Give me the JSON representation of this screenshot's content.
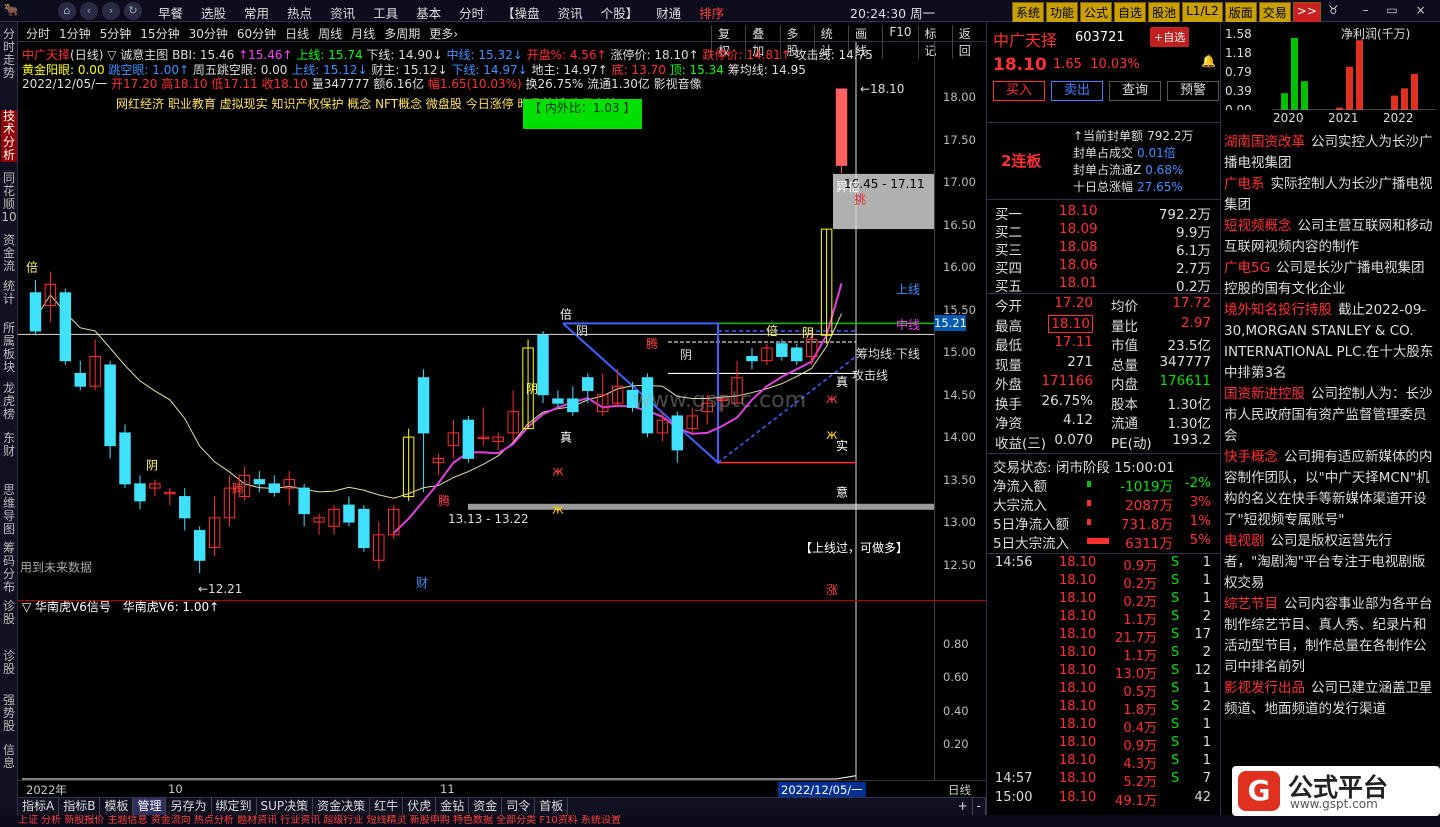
{
  "topbar": {
    "menu": [
      "早餐",
      "选股",
      "常用",
      "热点",
      "资讯",
      "工具",
      "基本",
      "分时",
      "【操盘",
      "资讯",
      "个股】",
      "财通",
      "排序"
    ],
    "clock": "20:24:30 周一",
    "buttons": [
      "系统",
      "功能",
      "公式",
      "自选",
      "股池",
      "L1/L2",
      "版面",
      "交易",
      ">>"
    ]
  },
  "sidetabs": [
    "分时走势",
    "技术分析",
    "同花顺10",
    "资金流",
    "统计",
    "所属板块",
    "龙虎榜",
    "东财",
    "思维导图",
    "筹码分布",
    "诊股",
    "诊股",
    "强势股",
    "信息"
  ],
  "periods": [
    "分时",
    "1分钟",
    "5分钟",
    "15分钟",
    "30分钟",
    "60分钟",
    "日线",
    "周线",
    "月线",
    "多周期",
    "更多›"
  ],
  "tools": [
    "复权",
    "叠加",
    "多股",
    "统计",
    "画线",
    "F10",
    "标记",
    "返回"
  ],
  "indicators": {
    "line1": [
      {
        "t": "中广天择",
        "c": "#ff3030"
      },
      {
        "t": "(日线)",
        "c": "#ddd"
      },
      {
        "t": " ▽ 诚意主图",
        "c": "#ddd"
      },
      {
        "t": " BBI: 15.46",
        "c": "#ddd"
      },
      {
        "t": " ↑15.46↑",
        "c": "#ff40ff"
      },
      {
        "t": " 上线: 15.74",
        "c": "#00ff00"
      },
      {
        "t": " 下线: 14.90↓",
        "c": "#ddd"
      },
      {
        "t": " 中线: 15.32↓",
        "c": "#4090ff"
      },
      {
        "t": " 开盘%: 4.56↑",
        "c": "#ff3030"
      },
      {
        "t": " 涨停价: 18.10↑",
        "c": "#ddd"
      },
      {
        "t": " 跌停价: 14.81↑",
        "c": "#ff3030"
      },
      {
        "t": " 攻击线: 14.75",
        "c": "#ddd"
      }
    ],
    "line2": [
      {
        "t": "黄金阳眼: 0.00",
        "c": "#ffff00"
      },
      {
        "t": " 跳空眼: 1.00↑",
        "c": "#4090ff"
      },
      {
        "t": " 周五跳空眼: 0.00",
        "c": "#ddd"
      },
      {
        "t": " 上线: 15.12↓",
        "c": "#4090ff"
      },
      {
        "t": " 财主: 15.12↓",
        "c": "#ddd"
      },
      {
        "t": " 下线: 14.97↓",
        "c": "#4090ff"
      },
      {
        "t": " 地主: 14.97↑",
        "c": "#ddd"
      },
      {
        "t": " 底: 13.70",
        "c": "#ff3030"
      },
      {
        "t": " 顶: 15.34",
        "c": "#00ff00"
      },
      {
        "t": " 筹均线: 14.95",
        "c": "#ddd"
      }
    ],
    "line3": [
      {
        "t": "2022/12/05/一",
        "c": "#ddd"
      },
      {
        "t": " 开17.20",
        "c": "#ff3030"
      },
      {
        "t": " 高18.10",
        "c": "#ff3030"
      },
      {
        "t": " 低17.11",
        "c": "#ff3030"
      },
      {
        "t": " 收18.10",
        "c": "#ff3030"
      },
      {
        "t": " 量347777",
        "c": "#ddd"
      },
      {
        "t": " 额6.16亿",
        "c": "#ddd"
      },
      {
        "t": " 幅1.65(10.03%)",
        "c": "#ff3030"
      },
      {
        "t": " 换26.75%",
        "c": "#ddd"
      },
      {
        "t": " 流通1.30亿",
        "c": "#ddd"
      },
      {
        "t": " 影视音像",
        "c": "#ddd"
      }
    ],
    "concepts": "网红经济 职业教育 虚拟现实 知识产权保护 概念 NFT概念       微盘股     今日涨停 昨日首板 昨日上榜",
    "inner_outer": "【 内外比：1.03 】"
  },
  "chart_data": {
    "type": "candlestick",
    "ylim": [
      12.2,
      18.3
    ],
    "yticks": [
      18.0,
      17.5,
      17.0,
      16.5,
      16.0,
      15.5,
      15.0,
      14.5,
      14.0,
      13.5,
      13.0,
      12.5
    ],
    "candles": [
      [
        15.7,
        15.25,
        15.85,
        15.2
      ],
      [
        15.55,
        15.8,
        15.95,
        15.35
      ],
      [
        15.7,
        14.9,
        15.75,
        14.85
      ],
      [
        14.75,
        14.6,
        14.9,
        14.55
      ],
      [
        14.6,
        14.95,
        15.15,
        14.55
      ],
      [
        14.85,
        13.9,
        14.9,
        13.75
      ],
      [
        14.05,
        13.45,
        14.15,
        13.4
      ],
      [
        13.45,
        13.25,
        13.55,
        13.15
      ],
      [
        13.4,
        13.45,
        13.5,
        13.3
      ],
      [
        13.35,
        13.35,
        13.4,
        13.2
      ],
      [
        13.3,
        13.05,
        13.4,
        12.9
      ],
      [
        12.9,
        12.55,
        12.95,
        12.4
      ],
      [
        12.7,
        13.05,
        13.3,
        12.6
      ],
      [
        13.05,
        13.4,
        13.55,
        12.95
      ],
      [
        13.3,
        13.55,
        13.65,
        13.25
      ],
      [
        13.5,
        13.45,
        13.6,
        13.35
      ],
      [
        13.45,
        13.35,
        13.55,
        13.3
      ],
      [
        13.4,
        13.5,
        13.6,
        13.2
      ],
      [
        13.4,
        13.1,
        13.45,
        12.95
      ],
      [
        13.0,
        13.05,
        13.1,
        12.85
      ],
      [
        12.95,
        13.15,
        13.2,
        12.85
      ],
      [
        13.2,
        13.0,
        13.3,
        12.95
      ],
      [
        13.15,
        12.7,
        13.2,
        12.65
      ],
      [
        12.55,
        12.85,
        13.0,
        12.45
      ],
      [
        12.85,
        13.15,
        13.2,
        12.8
      ],
      [
        13.3,
        14.0,
        14.1,
        13.25
      ],
      [
        14.7,
        14.05,
        14.8,
        13.35
      ],
      [
        13.7,
        13.75,
        13.8,
        13.55
      ],
      [
        13.9,
        14.05,
        14.2,
        13.75
      ],
      [
        14.2,
        13.75,
        14.25,
        13.7
      ],
      [
        14.0,
        14.0,
        14.35,
        13.9
      ],
      [
        13.95,
        14.0,
        14.05,
        13.85
      ],
      [
        14.05,
        14.3,
        14.55,
        13.95
      ],
      [
        14.1,
        15.05,
        15.15,
        14.1
      ],
      [
        15.2,
        14.5,
        15.25,
        14.4
      ],
      [
        14.45,
        14.4,
        14.55,
        14.35
      ],
      [
        14.45,
        14.3,
        14.6,
        14.25
      ],
      [
        14.7,
        14.55,
        14.75,
        14.4
      ],
      [
        14.3,
        14.5,
        14.75,
        14.25
      ],
      [
        14.4,
        14.6,
        14.8,
        14.35
      ],
      [
        14.55,
        14.35,
        14.65,
        14.3
      ],
      [
        14.7,
        14.05,
        14.75,
        14.0
      ],
      [
        14.05,
        14.2,
        14.3,
        13.95
      ],
      [
        14.25,
        13.85,
        14.3,
        13.7
      ],
      [
        14.1,
        14.25,
        14.35,
        14.05
      ],
      [
        14.3,
        14.4,
        14.5,
        14.15
      ],
      [
        14.45,
        14.45,
        14.5,
        14.3
      ],
      [
        14.4,
        14.7,
        14.9,
        14.4
      ],
      [
        14.95,
        14.9,
        15.05,
        14.8
      ],
      [
        14.9,
        15.05,
        15.1,
        14.85
      ],
      [
        15.1,
        14.95,
        15.15,
        14.9
      ],
      [
        15.05,
        14.9,
        15.1,
        14.85
      ],
      [
        14.95,
        15.15,
        15.25,
        14.85
      ],
      [
        15.2,
        16.45,
        16.45,
        15.1
      ],
      [
        17.2,
        18.1,
        18.1,
        17.11
      ]
    ],
    "labels": {
      "low_label": "←12.21",
      "range1": "13.13 - 13.22",
      "range2": "16.45 - 17.11",
      "high_label": "←18.10",
      "shang": "上线",
      "zhong": "中线",
      "chou": "筹均线·下线",
      "gongji": "攻击线",
      "bei": "倍",
      "yin": "阴",
      "teng": "腾",
      "zhen": "真",
      "shi": "实",
      "yi": "意",
      "yibei": "异倍",
      "zhang": "涨",
      "cai": "财",
      "tiao": "挑",
      "future": "用到未来数据",
      "hint": "【上线过，可做多】",
      "price_tag": "15.21",
      "wm": "www.gsptc.com"
    }
  },
  "sub": {
    "title": "▽ 华南虎V6信号",
    "value": "华南虎V6: 1.00↑",
    "yticks": [
      "0.80",
      "0.60",
      "0.40",
      "0.20"
    ],
    "year": "2022年",
    "m10": "10",
    "m11": "11",
    "date": "2022/12/05/一",
    "period": "日线"
  },
  "bottomtabs": [
    "指标A",
    "指标B",
    "模板",
    "管理",
    "另存为",
    "绑定到",
    "SUP决策",
    "资金决策",
    "红牛",
    "伏虎",
    "金钻",
    "资金",
    "司令",
    "首板",
    "+",
    "-"
  ],
  "statusbar": "上证  分析 新股报价  主题信息 资金流向 热点分析  题材资讯 行业资讯  超级行业 短线精灵 新股申购 特色数据 全部分类  F10资料 系统设置",
  "quote": {
    "name": "中广天择",
    "code": "603721",
    "add": "+自选",
    "price": "18.10",
    "chg": "1.65",
    "pct": "10.03%",
    "actions": [
      "买入",
      "卖出",
      "查询",
      "预警"
    ],
    "lianban": "2连板",
    "seal": [
      [
        "↑当前封单额",
        "792.2万"
      ],
      [
        "封单占成交",
        "0.01倍"
      ],
      [
        "封单占流通Z",
        "0.68%"
      ],
      [
        "十日总涨幅",
        "27.65%"
      ]
    ],
    "bids": [
      [
        "买一",
        "18.10",
        "792.2万"
      ],
      [
        "买二",
        "18.09",
        "9.9万"
      ],
      [
        "买三",
        "18.08",
        "6.1万"
      ],
      [
        "买四",
        "18.06",
        "2.7万"
      ],
      [
        "买五",
        "18.01",
        "0.2万"
      ]
    ],
    "stats": [
      [
        "今开",
        "17.20",
        "均价",
        "17.72"
      ],
      [
        "最高",
        "18.10",
        "量比",
        "2.97"
      ],
      [
        "最低",
        "17.11",
        "市值",
        "23.5亿"
      ],
      [
        "现量",
        "271",
        "总量",
        "347777"
      ],
      [
        "外盘",
        "171166",
        "内盘",
        "176611"
      ],
      [
        "换手",
        "26.75%",
        "股本",
        "1.30亿"
      ],
      [
        "净资",
        "4.12",
        "流通",
        "1.30亿"
      ],
      [
        "收益(三)",
        "0.070",
        "PE(动)",
        "193.2"
      ]
    ],
    "trade_state": "交易状态: 闭市阶段 15:00:01",
    "flows": [
      [
        "净流入额",
        "-1019万",
        "-2%"
      ],
      [
        "大宗流入",
        "2087万",
        "3%"
      ],
      [
        "5日净流入额",
        "731.8万",
        "1%"
      ],
      [
        "5日大宗流入",
        "6311万",
        "5%"
      ]
    ],
    "ticks": [
      [
        "14:56",
        "18.10",
        "0.9万",
        "S",
        "1"
      ],
      [
        "",
        "18.10",
        "0.2万",
        "S",
        "1"
      ],
      [
        "",
        "18.10",
        "0.2万",
        "S",
        "1"
      ],
      [
        "",
        "18.10",
        "1.1万",
        "S",
        "2"
      ],
      [
        "",
        "18.10",
        "21.7万",
        "S",
        "17"
      ],
      [
        "",
        "18.10",
        "1.1万",
        "S",
        "2"
      ],
      [
        "",
        "18.10",
        "13.0万",
        "S",
        "12"
      ],
      [
        "",
        "18.10",
        "0.5万",
        "S",
        "1"
      ],
      [
        "",
        "18.10",
        "1.8万",
        "S",
        "2"
      ],
      [
        "",
        "18.10",
        "0.4万",
        "S",
        "1"
      ],
      [
        "",
        "18.10",
        "0.9万",
        "S",
        "1"
      ],
      [
        "",
        "18.10",
        "4.3万",
        "S",
        "1"
      ],
      [
        "14:57",
        "18.10",
        "5.2万",
        "S",
        "7"
      ],
      [
        "15:00",
        "18.10",
        "49.1万",
        "",
        "42"
      ]
    ]
  },
  "profit": {
    "title": "净利润(千万)",
    "yticks": [
      "1.58",
      "1.18",
      "0.79",
      "0.39",
      "0.00"
    ],
    "years": [
      "2020",
      "2021",
      "2022"
    ],
    "bars": [
      [
        0.35,
        1.5,
        0.6
      ],
      [
        0.05,
        0.9,
        1.45
      ],
      [
        0.3,
        0.45,
        0.75
      ]
    ],
    "colors": [
      "#00c000",
      "#e03020",
      "#e03020"
    ]
  },
  "news": [
    [
      "湖南国资改革",
      "公司实控人为长沙广播电视集团"
    ],
    [
      "广电系",
      "实际控制人为长沙广播电视集团"
    ],
    [
      "短视频概念",
      "公司主营互联网和移动互联网视频内容的制作"
    ],
    [
      "广电5G",
      "公司是长沙广播电视集团控股的国有文化企业"
    ],
    [
      "境外知名投行持股",
      "截止2022-09-30,MORGAN STANLEY & CO. INTERNATIONAL PLC.在十大股东中排第3名"
    ],
    [
      "国资新进控股",
      "公司控制人为：长沙市人民政府国有资产监督管理委员会"
    ],
    [
      "快手概念",
      "公司拥有适应新媒体的内容制作团队，以\"中广天择MCN\"机构的名义在快手等新媒体渠道开设了\"短视频专属账号\""
    ],
    [
      "电视剧",
      "公司是版权运营先行者，\"淘剧淘\"平台专注于电视剧版权交易"
    ],
    [
      "综艺节目",
      "公司内容事业部为各平台制作综艺节目、真人秀、纪录片和活动型节目，制作总量在各制作公司中排名前列"
    ],
    [
      "影视发行出品",
      "公司已建立涵盖卫星频道、地面频道的发行渠道"
    ]
  ],
  "logo": {
    "icon": "G",
    "name": "公式平台",
    "url": "www.gspt.com"
  }
}
